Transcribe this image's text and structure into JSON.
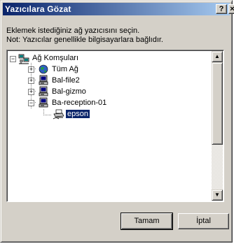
{
  "window": {
    "title": "Yazıcılara Gözat",
    "help_label": "?",
    "close_label": "×"
  },
  "description": {
    "line1": "Eklemek istediğiniz ağ yazıcısını seçin.",
    "line2": "Not: Yazıcılar genellikle bilgisayarlara bağlıdır."
  },
  "tree": {
    "root": {
      "label": "Ağ Komşuları",
      "expander": "−",
      "icon": "network-neighborhood-icon"
    },
    "items": [
      {
        "label": "Tüm Ağ",
        "expander": "+",
        "icon": "globe-icon"
      },
      {
        "label": "Bal-file2",
        "expander": "+",
        "icon": "computer-icon"
      },
      {
        "label": "Bal-gizmo",
        "expander": "+",
        "icon": "computer-icon"
      },
      {
        "label": "Ba-reception-01",
        "expander": "−",
        "icon": "computer-icon"
      }
    ],
    "selected": {
      "label": "epson",
      "icon": "printer-icon"
    }
  },
  "scrollbar": {
    "up": "▲",
    "down": "▼"
  },
  "buttons": {
    "ok": "Tamam",
    "cancel": "İptal"
  }
}
